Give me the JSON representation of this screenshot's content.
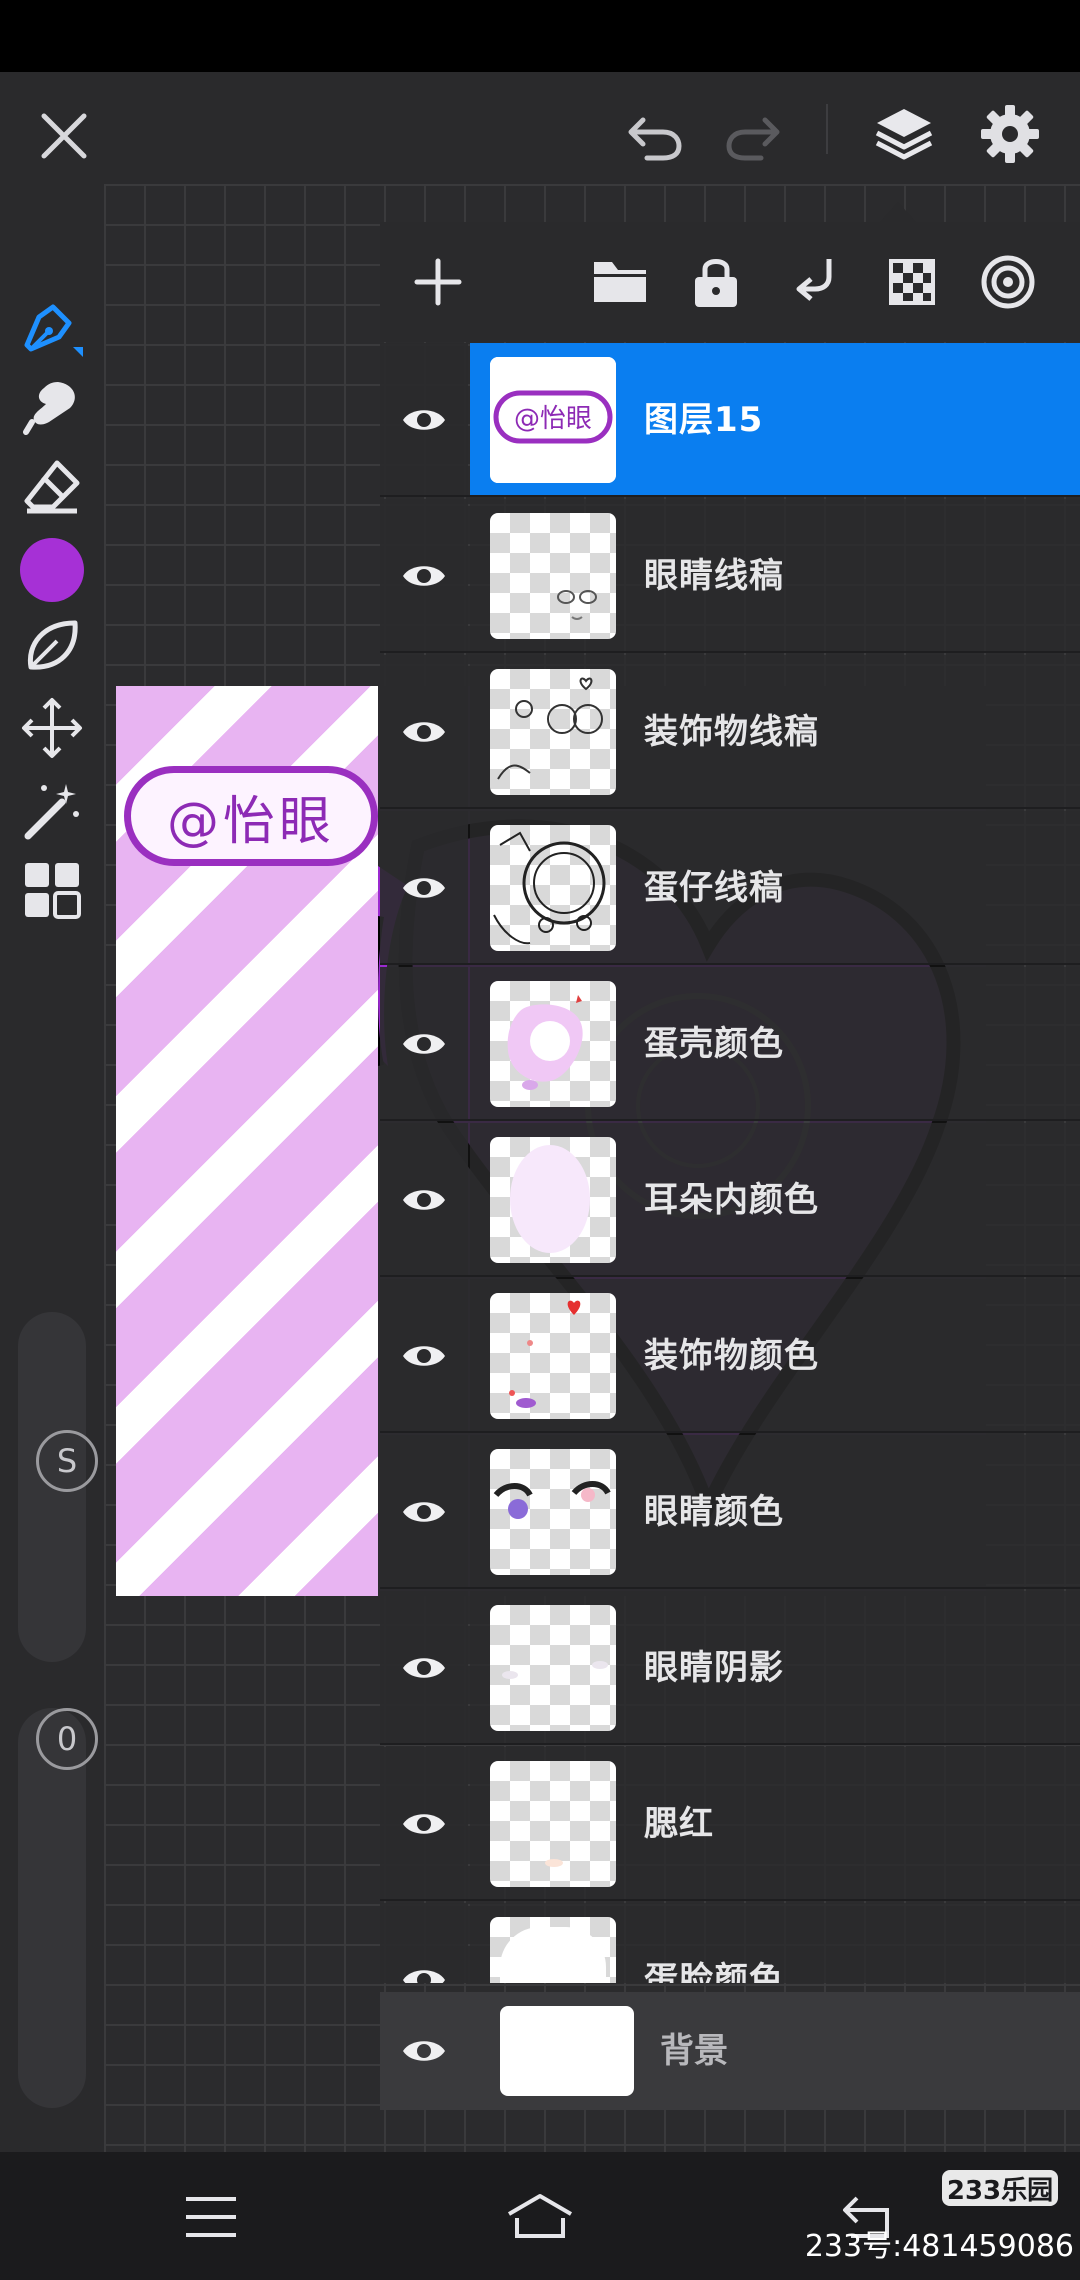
{
  "app": {
    "top_bar": {
      "close_icon": "close-icon",
      "undo_icon": "undo-icon",
      "redo_icon": "redo-icon",
      "layers_icon": "layers-icon",
      "settings_icon": "gear-icon"
    },
    "left_toolbar": {
      "tools": [
        "pen-tool-icon",
        "smudge-tool-icon",
        "eraser-tool-icon",
        "color-picker",
        "lasso-tool-icon",
        "transform-tool-icon",
        "magic-wand-icon",
        "gallery-icon"
      ],
      "current_color": "#a630d6",
      "size_slider_label": "S",
      "opacity_slider_label": "0"
    },
    "artwork": {
      "badge_text": "@怡眼"
    }
  },
  "layers_panel": {
    "toolbar": [
      "add-layer-icon",
      "folder-icon",
      "lock-icon",
      "merge-down-icon",
      "alpha-lock-icon",
      "clipping-mask-icon"
    ],
    "layers": [
      {
        "name": "图层15",
        "selected": true,
        "thumb": "badge"
      },
      {
        "name": "眼睛线稿",
        "selected": false,
        "thumb": "eyes-lineart"
      },
      {
        "name": "装饰物线稿",
        "selected": false,
        "thumb": "deco-lineart"
      },
      {
        "name": "蛋仔线稿",
        "selected": false,
        "thumb": "body-lineart"
      },
      {
        "name": "蛋壳颜色",
        "selected": false,
        "thumb": "shell-color"
      },
      {
        "name": "耳朵内颜色",
        "selected": false,
        "thumb": "ear-color"
      },
      {
        "name": "装饰物颜色",
        "selected": false,
        "thumb": "deco-color"
      },
      {
        "name": "眼睛颜色",
        "selected": false,
        "thumb": "eye-color"
      },
      {
        "name": "眼睛阴影",
        "selected": false,
        "thumb": "eye-shadow"
      },
      {
        "name": "腮红",
        "selected": false,
        "thumb": "blush"
      },
      {
        "name": "蛋脸颜色",
        "selected": false,
        "thumb": "face-color"
      }
    ],
    "background_layer": {
      "name": "背景"
    }
  },
  "navbar": {
    "menu_icon": "menu-icon",
    "home_icon": "home-icon",
    "back_icon": "back-icon"
  },
  "watermark": {
    "logo_text": "233乐园",
    "id_text": "233号:481459086"
  },
  "colors": {
    "accent": "#0a7ef0",
    "tool_active": "#1e90ff",
    "background": "#2a2a2c",
    "artwork_purple": "#a630d6"
  }
}
